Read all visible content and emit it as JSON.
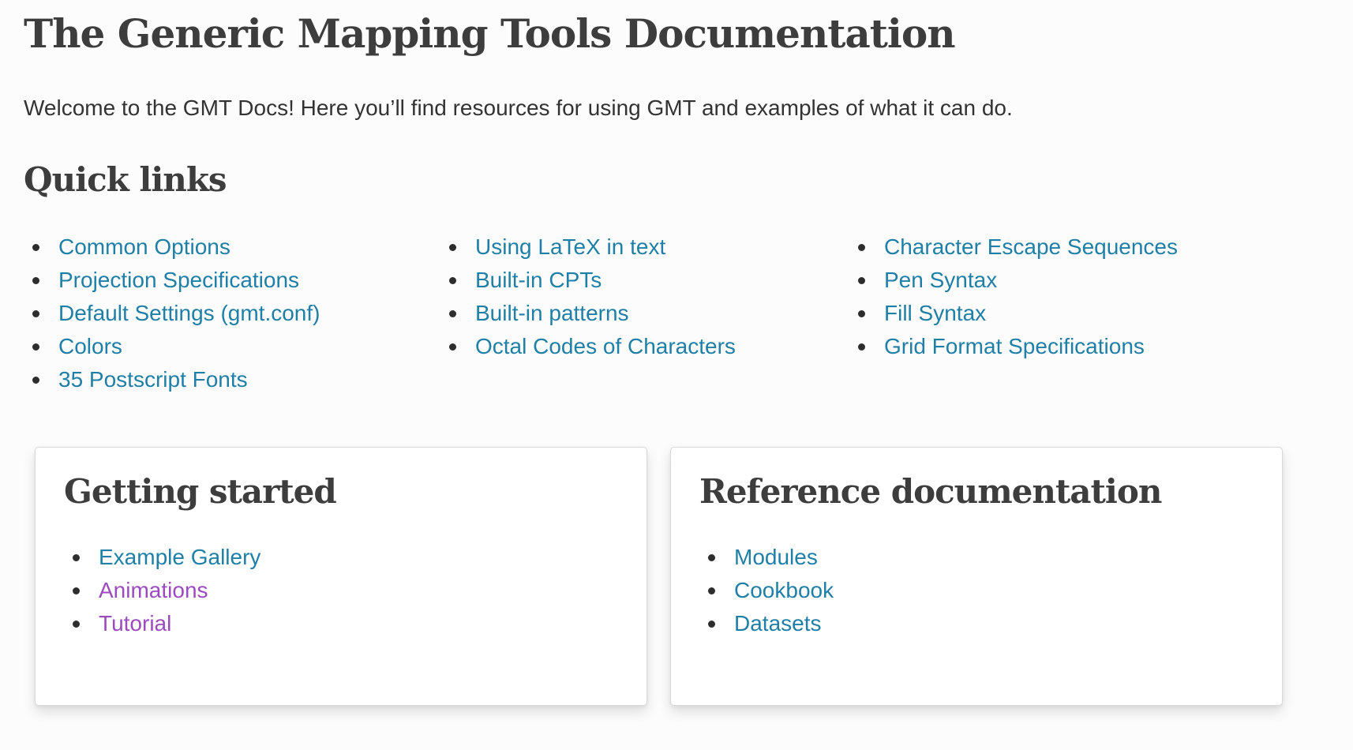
{
  "page": {
    "title": "The Generic Mapping Tools Documentation",
    "intro": "Welcome to the GMT Docs! Here you’ll find resources for using GMT and examples of what it can do."
  },
  "quick_links": {
    "heading": "Quick links",
    "columns": [
      [
        "Common Options",
        "Projection Specifications",
        "Default Settings (gmt.conf)",
        "Colors",
        "35 Postscript Fonts"
      ],
      [
        "Using LaTeX in text",
        "Built-in CPTs",
        "Built-in patterns",
        "Octal Codes of Characters"
      ],
      [
        "Character Escape Sequences",
        "Pen Syntax",
        "Fill Syntax",
        "Grid Format Specifications"
      ]
    ]
  },
  "cards": {
    "getting_started": {
      "heading": "Getting started",
      "links": [
        "Example Gallery",
        "Animations",
        "Tutorial"
      ]
    },
    "reference": {
      "heading": "Reference documentation",
      "links": [
        "Modules",
        "Cookbook",
        "Datasets"
      ]
    }
  },
  "colors": {
    "link": "#1f7fa6",
    "visited_link": "#9b4bbf",
    "heading": "#3d3d3d",
    "background": "#fcfcfc"
  }
}
